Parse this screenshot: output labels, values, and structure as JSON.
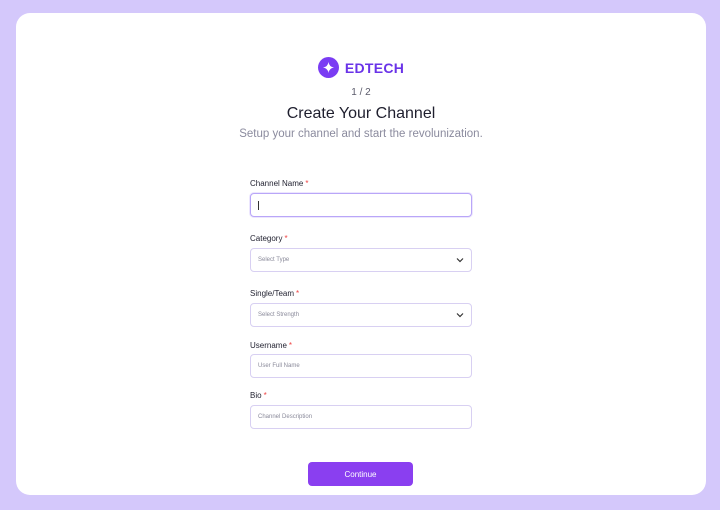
{
  "brand": {
    "name": "EDTECH",
    "icon": "sparkle-icon"
  },
  "step": "1 / 2",
  "title": "Create Your Channel",
  "subtitle": "Setup your channel and start the revolunization.",
  "required_marker": "*",
  "form": {
    "channel_name": {
      "label": "Channel Name",
      "value": ""
    },
    "category": {
      "label": "Category",
      "placeholder": "Select  Type"
    },
    "single_team": {
      "label": "Single/Team",
      "placeholder": "Select Strength"
    },
    "username": {
      "label": "Username",
      "placeholder": "User Full Name"
    },
    "bio": {
      "label": "Bio",
      "placeholder": "Channel Description"
    }
  },
  "continue_label": "Continue",
  "colors": {
    "background": "#d4c8fb",
    "accent": "#8a3ff0",
    "brand": "#6a33e8",
    "required": "#ef4444"
  }
}
